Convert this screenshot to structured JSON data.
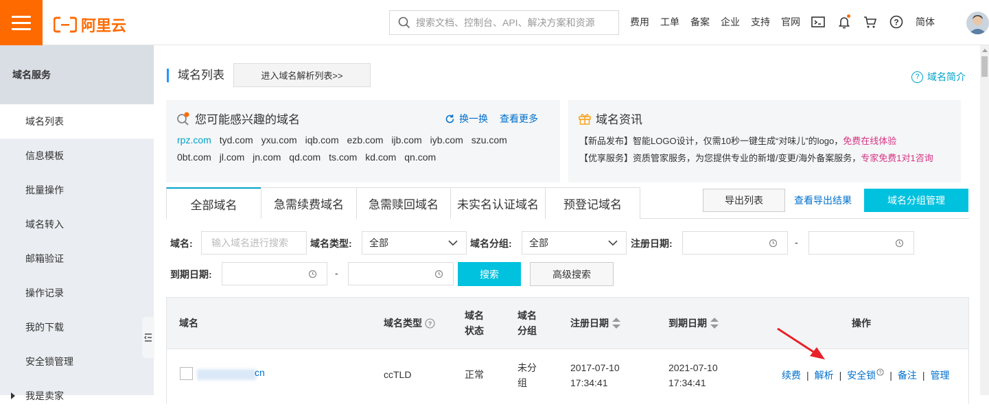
{
  "brand": {
    "name": "阿里云",
    "color": "#ff6a00"
  },
  "topnav": {
    "search_placeholder": "搜索文档、控制台、API、解决方案和资源",
    "links": [
      "费用",
      "工单",
      "备案",
      "企业",
      "支持",
      "官网"
    ],
    "lang": "简体",
    "icons": [
      "terminal-icon",
      "bell-icon",
      "cart-icon",
      "help-icon"
    ]
  },
  "sidebar": {
    "title": "域名服务",
    "items": [
      "域名列表",
      "信息模板",
      "批量操作",
      "域名转入",
      "邮箱验证",
      "操作记录",
      "我的下载",
      "安全锁管理",
      "我是卖家"
    ],
    "active_index": 0
  },
  "page": {
    "title": "域名列表",
    "jump_button": "进入域名解析列表>>",
    "intro_link": "域名简介"
  },
  "interest": {
    "title": "您可能感兴趣的域名",
    "refresh": "换一换",
    "more": "查看更多",
    "row1": [
      "rpz.com",
      "tyd.com",
      "yxu.com",
      "iqb.com",
      "ezb.com",
      "ijb.com",
      "iyb.com",
      "szu.com"
    ],
    "row2": [
      "0bt.com",
      "jl.com",
      "jn.com",
      "qd.com",
      "ts.com",
      "kd.com",
      "qn.com"
    ]
  },
  "news": {
    "title": "域名资讯",
    "line1_text": "【新品发布】智能LOGO设计，仅需10秒一键生成“对味儿”的logo，",
    "line1_link": "免费在线体验",
    "line2_text": "【优享服务】资质管家服务，为您提供专业的新增/变更/海外备案服务，",
    "line2_link": "专家免费1对1咨询"
  },
  "tabs": [
    "全部域名",
    "急需续费域名",
    "急需赎回域名",
    "未实名认证域名",
    "预登记域名"
  ],
  "actions": {
    "export": "导出列表",
    "view_export": "查看导出结果",
    "group_manage": "域名分组管理"
  },
  "filters": {
    "domain_label": "域名:",
    "domain_placeholder": "输入域名进行搜索",
    "type_label": "域名类型:",
    "type_value": "全部",
    "group_label": "域名分组:",
    "group_value": "全部",
    "reg_label": "注册日期:",
    "exp_label": "到期日期:",
    "dash": "-",
    "search": "搜索",
    "advanced": "高级搜索"
  },
  "table": {
    "headers": {
      "domain": "域名",
      "type": "域名类型",
      "status_line1": "域名",
      "status_line2": "状态",
      "group_line1": "域名",
      "group_line2": "分组",
      "reg_date": "注册日期",
      "exp_date": "到期日期",
      "ops": "操作"
    },
    "rows": [
      {
        "domain_suffix": "cn",
        "type": "ccTLD",
        "status": "正常",
        "group_line1": "未分",
        "group_line2": "组",
        "reg_date": "2017-07-10",
        "reg_time": "17:34:41",
        "exp_date": "2021-07-10",
        "exp_time": "17:34:41",
        "ops": [
          "续费",
          "解析",
          "安全锁",
          "备注",
          "管理"
        ]
      }
    ]
  },
  "colors": {
    "accent": "#00c1de",
    "link": "#0070cc",
    "highlight": "#d63384",
    "annotation": "#e8202a"
  }
}
